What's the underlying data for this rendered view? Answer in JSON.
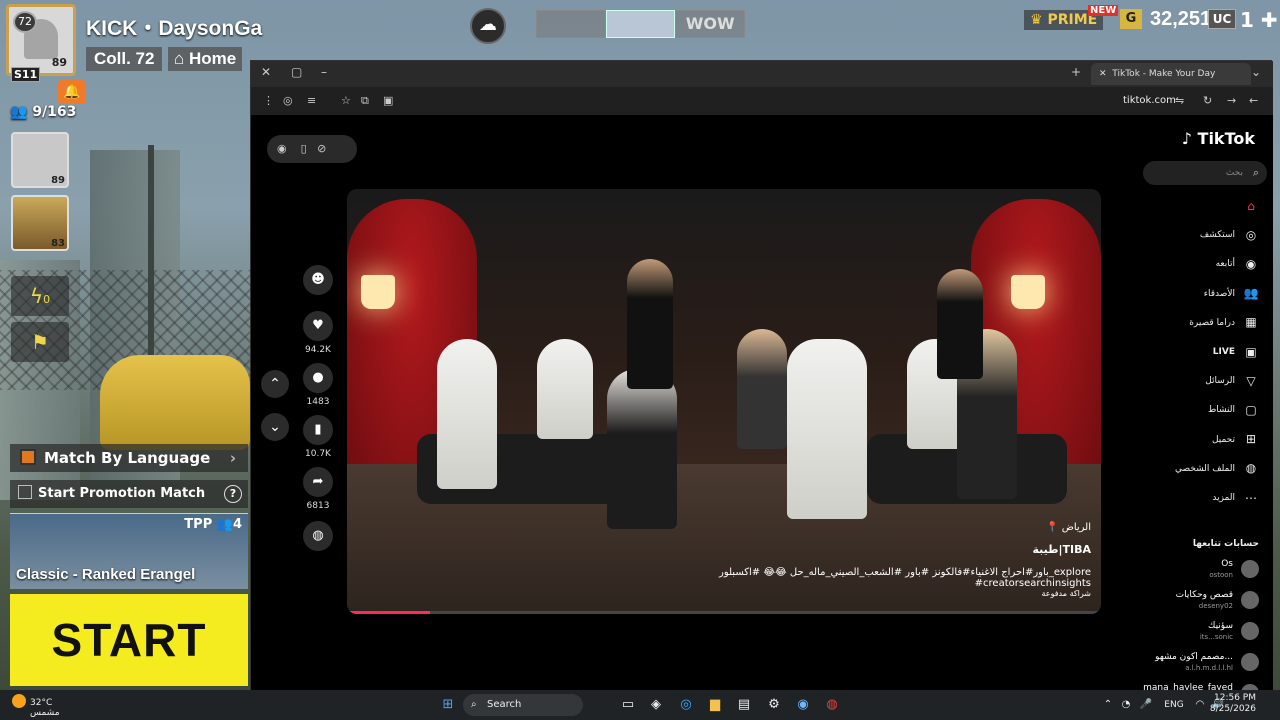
{
  "game": {
    "level_badge": "72",
    "season_badge": "S11",
    "avatar_level": "89",
    "player_name": "KICK・DaysonGa",
    "coll_label": "Coll. 72",
    "home_label": "Home",
    "team_count": "9/163",
    "slot1_level": "89",
    "slot2_level": "83",
    "energy_count": "0",
    "match_by_language": "Match By Language",
    "start_promotion": "Start Promotion Match",
    "mode_tpp": "TPP",
    "mode_squad": "4",
    "mode_title": "Classic - Ranked   Erangel",
    "start_label": "START",
    "top_tabs": [
      "",
      "",
      "WOW"
    ],
    "prime_label": "PRIME",
    "new_badge": "NEW",
    "coin_badge": "G",
    "coins": "32,251",
    "uc_badge": "UC",
    "uc_value": "1"
  },
  "browser": {
    "tab_title": "TikTok - Make Your Day",
    "url": "tiktok.com"
  },
  "tiktok": {
    "logo": "TikTok",
    "search_placeholder": "بحث",
    "nav": [
      {
        "label": "",
        "icon": "home-icon"
      },
      {
        "label": "استكشف",
        "icon": "compass-icon"
      },
      {
        "label": "أتابعه",
        "icon": "following-icon"
      },
      {
        "label": "الأصدقاء",
        "icon": "friends-icon"
      },
      {
        "label": "دراما قصيرة",
        "icon": "drama-icon"
      },
      {
        "label": "LIVE",
        "icon": "live-icon"
      },
      {
        "label": "الرسائل",
        "icon": "messages-icon"
      },
      {
        "label": "النشاط",
        "icon": "activity-icon"
      },
      {
        "label": "تحميل",
        "icon": "upload-icon"
      },
      {
        "label": "الملف الشخصي",
        "icon": "profile-icon"
      },
      {
        "label": "المزيد",
        "icon": "more-icon"
      }
    ],
    "following_header": "حسابات تتابعها",
    "following": [
      {
        "name": "Os",
        "handle": "ostoon"
      },
      {
        "name": "قصص وحكايات",
        "handle": "deseny02"
      },
      {
        "name": "سؤنيك",
        "handle": "its...sonic"
      },
      {
        "name": "مصمم اكون مشهو...",
        "handle": "a.l.h.m.d.l.l.hl"
      },
      {
        "name": "mana_haylee_fayed",
        "handle": ""
      }
    ],
    "actions": {
      "likes": "94.2K",
      "comments": "1483",
      "saves": "10.7K",
      "shares": "6813"
    },
    "video": {
      "location": "الرياض",
      "author": "طيبة|TIBA",
      "caption": "باور#احراج الاغنياء#فالكونز #باور #الشعب_الصيني_ماله_حل 😂😂 #اكسبلور_explore #creatorsearchinsights",
      "paid_label": "شراكة مدفوعة",
      "progress": 0.11
    }
  },
  "taskbar": {
    "temp": "32°C",
    "weather_text": "مشمس",
    "search_label": "Search",
    "lang": "ENG",
    "time": "12:56 PM",
    "date": "8/25/2026"
  }
}
